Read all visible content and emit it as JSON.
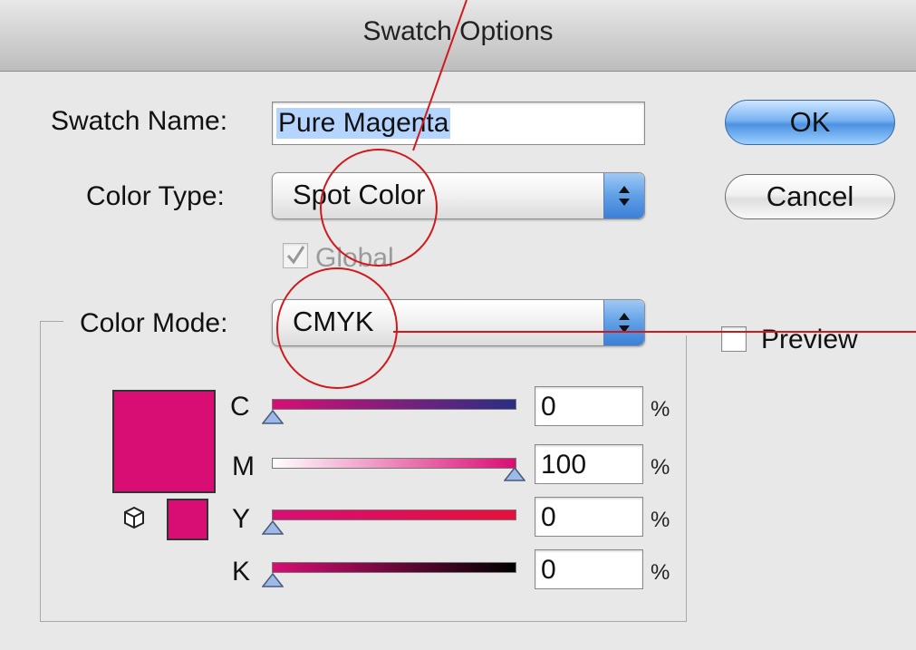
{
  "window": {
    "title": "Swatch Options"
  },
  "swatch_name": {
    "label": "Swatch Name:",
    "value": "Pure Magenta"
  },
  "color_type": {
    "label": "Color Type:",
    "value": "Spot Color"
  },
  "global": {
    "label": "Global",
    "checked": true,
    "enabled": false
  },
  "color_mode": {
    "label": "Color Mode:",
    "value": "CMYK"
  },
  "buttons": {
    "ok": "OK",
    "cancel": "Cancel"
  },
  "preview": {
    "label": "Preview",
    "checked": false
  },
  "sliders": [
    {
      "name": "C",
      "value": "0",
      "unit": "%"
    },
    {
      "name": "M",
      "value": "100",
      "unit": "%"
    },
    {
      "name": "Y",
      "value": "0",
      "unit": "%"
    },
    {
      "name": "K",
      "value": "0",
      "unit": "%"
    }
  ],
  "colors": {
    "swatch": "#d80e74",
    "annotation": "#d0191b",
    "button_blue": "#5f9fe6"
  },
  "icons": {
    "gamut": "cube-icon",
    "popup_arrows": "updown-arrows-icon"
  }
}
